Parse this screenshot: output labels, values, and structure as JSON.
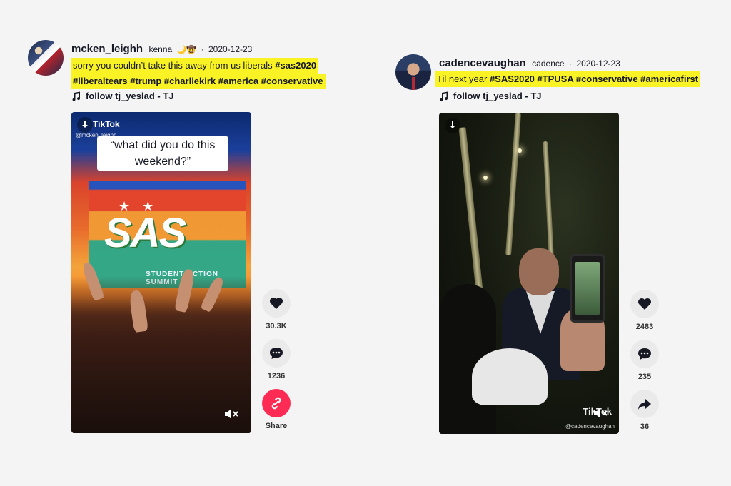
{
  "posts": [
    {
      "username": "mcken_leighh",
      "nickname": "kenna",
      "emoji": "🌙🤠",
      "date": "2020-12-23",
      "caption": {
        "line1_text": "sorry you couldn’t take this away from us liberals ",
        "line1_tag": "#sas2020",
        "line2_tags": "#liberaltears #trump #charliekirk #america #conservative"
      },
      "sound": "follow tj_yeslad - TJ",
      "video": {
        "brand": "TikTok",
        "handle": "@mcken_leighh",
        "overlay_text": "“what did you do this weekend?”",
        "sign_text": "SAS",
        "summit_text": "STUDENT ACTION SUMMIT"
      },
      "actions": [
        {
          "icon": "heart-icon",
          "count": "30.3K"
        },
        {
          "icon": "comment-icon",
          "count": "1236"
        },
        {
          "icon": "link-icon",
          "count": "Share"
        }
      ]
    },
    {
      "username": "cadencevaughan",
      "nickname": "cadence",
      "date": "2020-12-23",
      "caption": {
        "line1_text": "Til next year ",
        "line1_tag": "#SAS2020 #TPUSA #conservative #americafirst"
      },
      "sound": "follow tj_yeslad - TJ",
      "video": {
        "brand": "TikTok",
        "handle": "@cadencevaughan"
      },
      "actions": [
        {
          "icon": "heart-icon",
          "count": "2483"
        },
        {
          "icon": "comment-icon",
          "count": "235"
        },
        {
          "icon": "share-arrow-icon",
          "count": "36"
        }
      ]
    }
  ],
  "colors": {
    "highlight": "#f9f326",
    "share_red": "#fe2c55",
    "page_bg": "#f4f4f4"
  }
}
